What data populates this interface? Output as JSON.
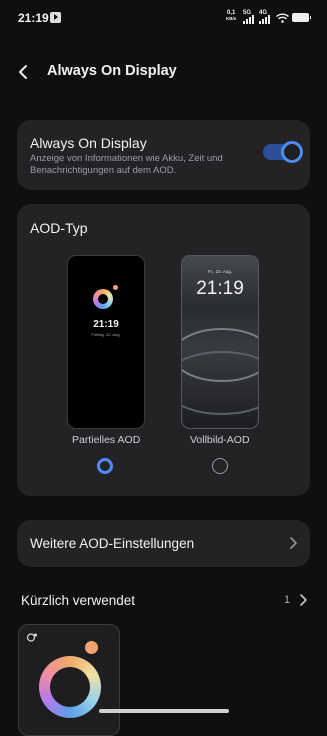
{
  "status_bar": {
    "time": "21:19",
    "net_speed_value": "0,1",
    "net_speed_unit": "KB/s",
    "sim1": "5G",
    "sim2": "4G"
  },
  "header": {
    "title": "Always On Display",
    "back_icon": "chevron-left-icon"
  },
  "toggle_card": {
    "title": "Always On Display",
    "description": "Anzeige von Informationen wie Akku, Zeit und Benachrichtigungen auf dem AOD.",
    "enabled": true
  },
  "aod_type": {
    "title": "AOD-Typ",
    "options": [
      {
        "label": "Partielles AOD",
        "selected": true,
        "preview_time": "21:19",
        "preview_date": "Freitag, 22. Aug."
      },
      {
        "label": "Vollbild-AOD",
        "selected": false,
        "preview_time": "21:19",
        "preview_date": "Fr., 22. Aug."
      }
    ]
  },
  "more_settings": {
    "label": "Weitere AOD-Einstellungen"
  },
  "recent": {
    "title": "Kürzlich verwendet",
    "count": "1"
  },
  "colors": {
    "accent": "#4f8af6",
    "card_bg": "#232326",
    "page_bg": "#0f0f10"
  }
}
